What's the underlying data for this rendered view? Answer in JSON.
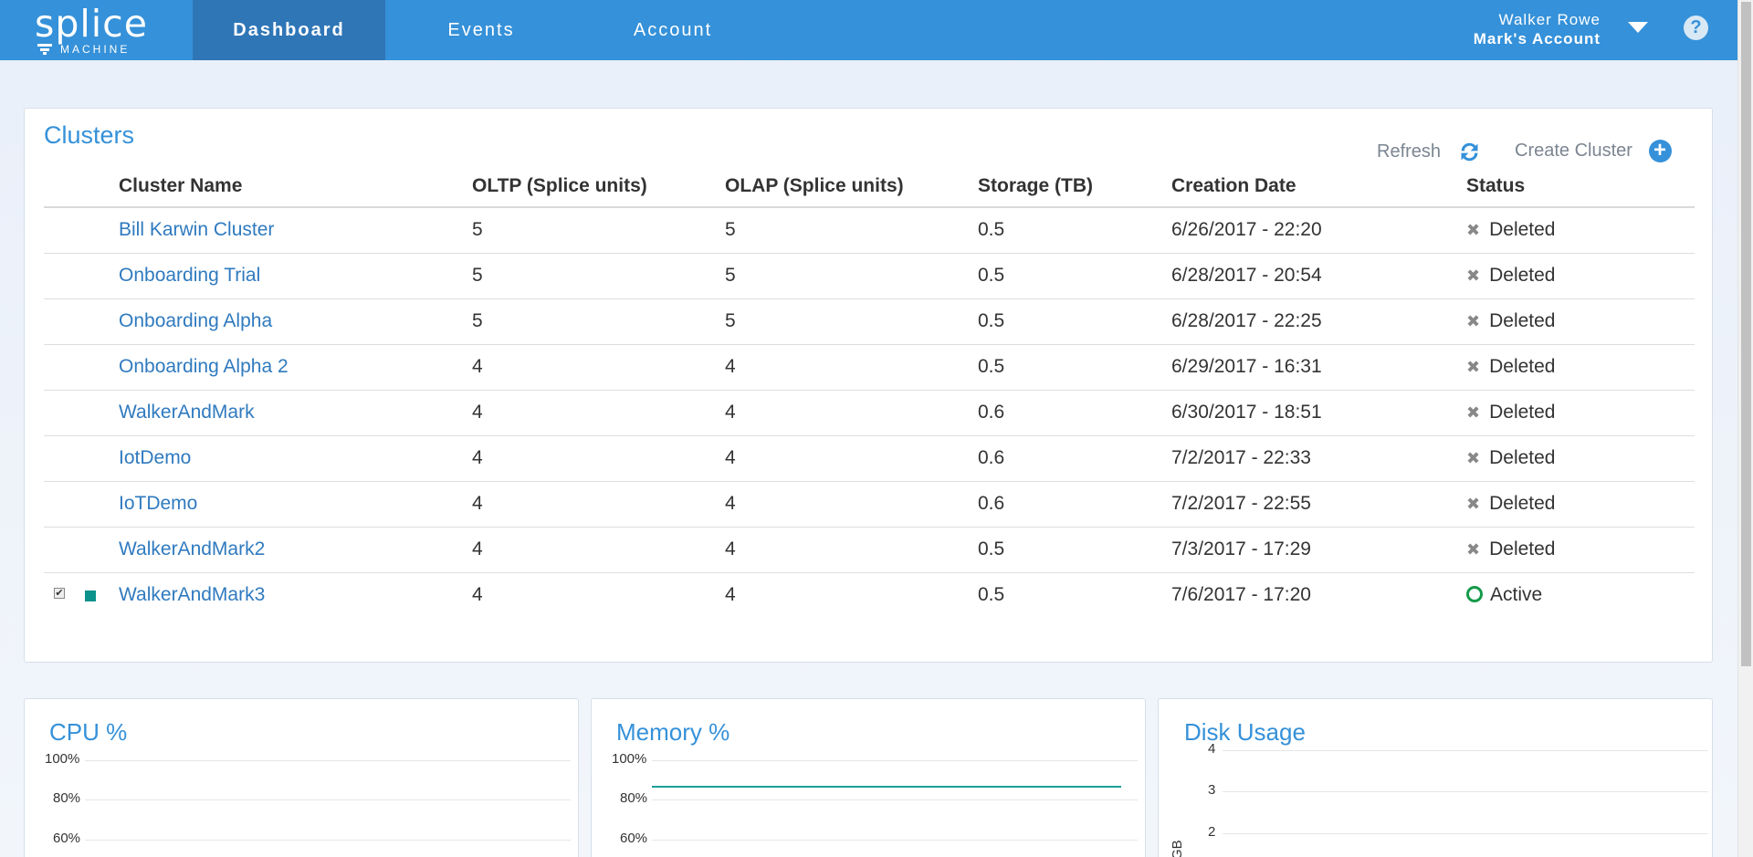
{
  "header": {
    "logo_word": "splice",
    "logo_sub": "MACHINE",
    "tabs": [
      {
        "label": "Dashboard",
        "active": true
      },
      {
        "label": "Events",
        "active": false
      },
      {
        "label": "Account",
        "active": false
      }
    ],
    "user_name": "Walker Rowe",
    "account_name": "Mark's Account",
    "help_glyph": "?"
  },
  "clusters": {
    "title": "Clusters",
    "refresh_label": "Refresh",
    "create_label": "Create Cluster",
    "columns": [
      "Cluster Name",
      "OLTP (Splice units)",
      "OLAP (Splice units)",
      "Storage (TB)",
      "Creation Date",
      "Status"
    ],
    "rows": [
      {
        "name": "Bill Karwin Cluster",
        "oltp": "5",
        "olap": "5",
        "storage": "0.5",
        "created": "6/26/2017 - 22:20",
        "status": "Deleted",
        "selected": false
      },
      {
        "name": "Onboarding Trial",
        "oltp": "5",
        "olap": "5",
        "storage": "0.5",
        "created": "6/28/2017 - 20:54",
        "status": "Deleted",
        "selected": false
      },
      {
        "name": "Onboarding Alpha",
        "oltp": "5",
        "olap": "5",
        "storage": "0.5",
        "created": "6/28/2017 - 22:25",
        "status": "Deleted",
        "selected": false
      },
      {
        "name": "Onboarding Alpha 2",
        "oltp": "4",
        "olap": "4",
        "storage": "0.5",
        "created": "6/29/2017 - 16:31",
        "status": "Deleted",
        "selected": false
      },
      {
        "name": "WalkerAndMark",
        "oltp": "4",
        "olap": "4",
        "storage": "0.6",
        "created": "6/30/2017 - 18:51",
        "status": "Deleted",
        "selected": false
      },
      {
        "name": "IotDemo",
        "oltp": "4",
        "olap": "4",
        "storage": "0.6",
        "created": "7/2/2017 - 22:33",
        "status": "Deleted",
        "selected": false
      },
      {
        "name": "IoTDemo",
        "oltp": "4",
        "olap": "4",
        "storage": "0.6",
        "created": "7/2/2017 - 22:55",
        "status": "Deleted",
        "selected": false
      },
      {
        "name": "WalkerAndMark2",
        "oltp": "4",
        "olap": "4",
        "storage": "0.5",
        "created": "7/3/2017 - 17:29",
        "status": "Deleted",
        "selected": false
      },
      {
        "name": "WalkerAndMark3",
        "oltp": "4",
        "olap": "4",
        "storage": "0.5",
        "created": "7/6/2017 - 17:20",
        "status": "Active",
        "selected": true
      }
    ]
  },
  "metrics": {
    "cpu": {
      "title": "CPU %",
      "ticks": [
        "100%",
        "80%",
        "60%"
      ]
    },
    "memory": {
      "title": "Memory %",
      "ticks": [
        "100%",
        "80%",
        "60%"
      ],
      "series_level_percent": 87
    },
    "disk": {
      "title": "Disk Usage",
      "ticks": [
        "4",
        "3",
        "2"
      ],
      "axis_label": "GB"
    }
  },
  "colors": {
    "brand": "#3591d9",
    "active_status": "#159a4a",
    "series": "#1aa19b"
  }
}
